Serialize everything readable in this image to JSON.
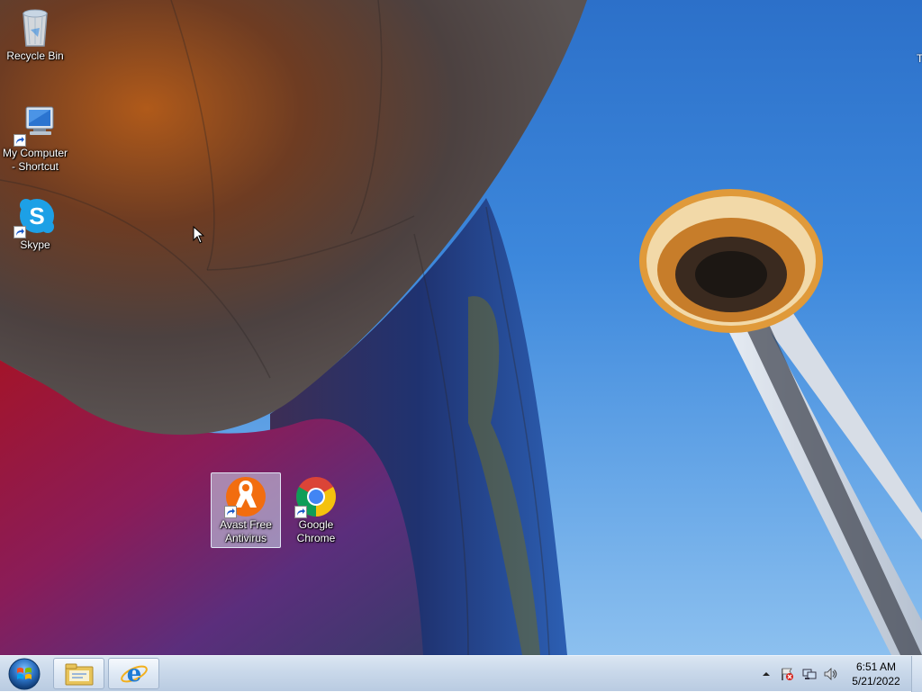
{
  "desktop_icons": [
    {
      "label": "Recycle Bin",
      "icon": "recycle-bin-icon"
    },
    {
      "label": "My Computer\n- Shortcut",
      "icon": "computer-icon"
    },
    {
      "label": "Skype",
      "icon": "skype-icon"
    },
    {
      "label": "Avast Free\nAntivirus",
      "icon": "avast-icon",
      "selected": true
    },
    {
      "label": "Google\nChrome",
      "icon": "chrome-icon"
    }
  ],
  "right_edge_text": "T",
  "taskbar": {
    "start": "windows-start-orb-icon",
    "pinned": [
      {
        "name": "Windows Explorer",
        "icon": "file-explorer-icon"
      },
      {
        "name": "Internet Explorer",
        "icon": "internet-explorer-icon"
      }
    ]
  },
  "tray": {
    "icons": [
      "show-hidden-icons-arrow-icon",
      "action-center-flag-icon",
      "network-icon",
      "volume-icon"
    ]
  },
  "clock": {
    "time": "6:51 AM",
    "date": "5/21/2022"
  }
}
